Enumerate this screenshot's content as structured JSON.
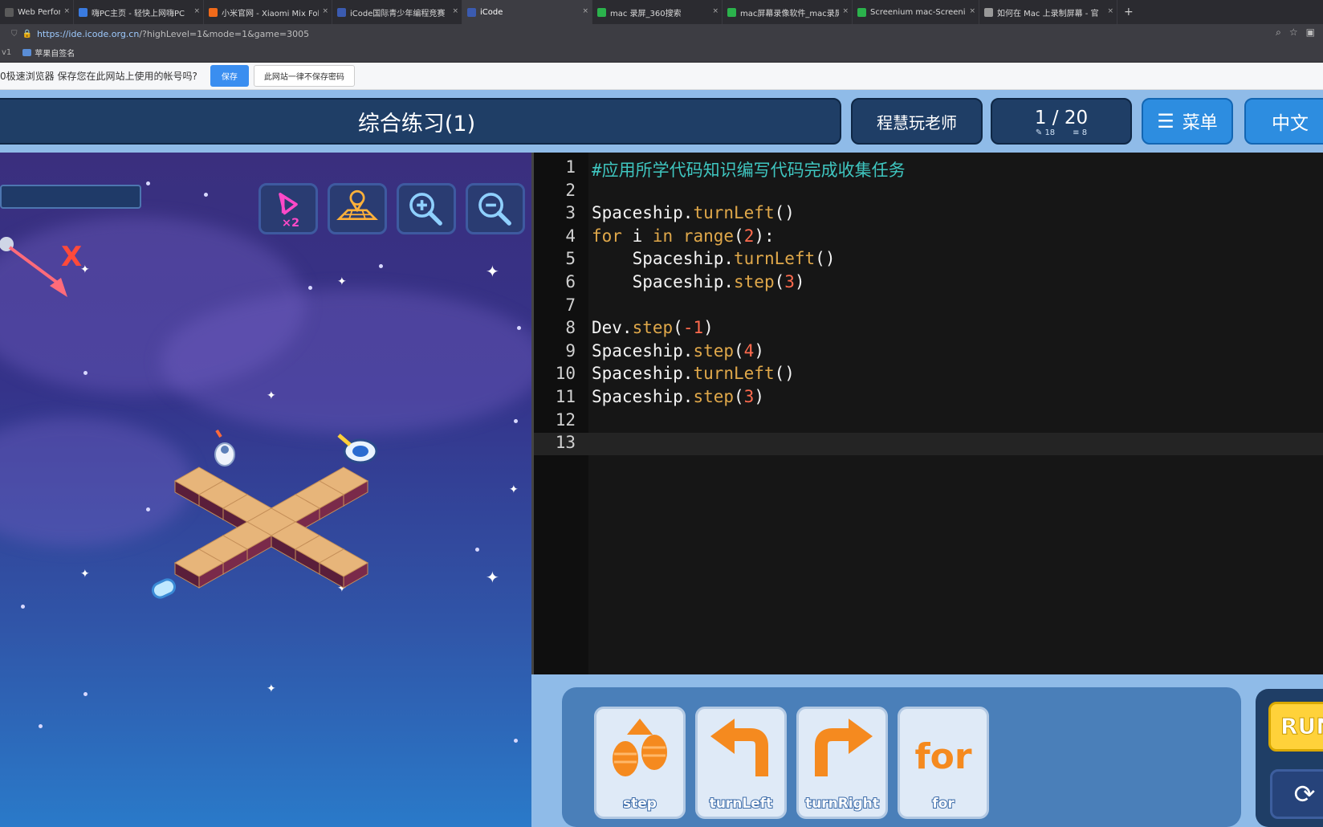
{
  "browser": {
    "tabs": [
      {
        "title": "Web Performan",
        "color": "#5a5a5a",
        "active": false
      },
      {
        "title": "嗨PC主页 - 轻快上网嗨PC",
        "color": "#3a7be0",
        "active": false
      },
      {
        "title": "小米官网 - Xiaomi Mix Fold",
        "color": "#f06a1a",
        "active": false
      },
      {
        "title": "iCode国际青少年编程竞赛",
        "color": "#3b5bb0",
        "active": false
      },
      {
        "title": "iCode",
        "color": "#3b5bb0",
        "active": true
      },
      {
        "title": "mac 录屏_360搜索",
        "color": "#2bb24c",
        "active": false
      },
      {
        "title": "mac屏幕录像软件_mac录屏",
        "color": "#2bb24c",
        "active": false
      },
      {
        "title": "Screenium mac-Screenium",
        "color": "#2bb24c",
        "active": false
      },
      {
        "title": "如何在 Mac 上录制屏幕 - 官",
        "color": "#999999",
        "active": false
      }
    ],
    "new_tab": "+",
    "url_host": "https://ide.icode.org.cn",
    "url_rest": "/?highLevel=1&mode=1&game=3005",
    "bookmark_prefix": "v1",
    "bookmark": "苹果自签名"
  },
  "password_bar": {
    "message": "0极速浏览器 保存您在此网站上使用的帐号吗?",
    "save": "保存",
    "never": "此网站一律不保存密码"
  },
  "header": {
    "level_title": "综合练习(1)",
    "teacher": "程慧玩老师",
    "progress": "1 / 20",
    "stat_a": "18",
    "stat_b": "8",
    "menu": "菜单",
    "language": "中文"
  },
  "scene": {
    "axis_label": "X"
  },
  "code": [
    [
      {
        "t": "#应用所学代码知识编写代码完成收集任务",
        "c": "com"
      }
    ],
    [],
    [
      {
        "t": "Spaceship."
      },
      {
        "t": "turnLeft",
        "c": "fn"
      },
      {
        "t": "()"
      }
    ],
    [
      {
        "t": "for",
        "c": "kw"
      },
      {
        "t": " i "
      },
      {
        "t": "in",
        "c": "kw"
      },
      {
        "t": " "
      },
      {
        "t": "range",
        "c": "fn"
      },
      {
        "t": "("
      },
      {
        "t": "2",
        "c": "num"
      },
      {
        "t": "):"
      }
    ],
    [
      {
        "t": "    Spaceship."
      },
      {
        "t": "turnLeft",
        "c": "fn"
      },
      {
        "t": "()"
      }
    ],
    [
      {
        "t": "    Spaceship."
      },
      {
        "t": "step",
        "c": "fn"
      },
      {
        "t": "("
      },
      {
        "t": "3",
        "c": "num"
      },
      {
        "t": ")"
      }
    ],
    [],
    [
      {
        "t": "Dev."
      },
      {
        "t": "step",
        "c": "fn"
      },
      {
        "t": "("
      },
      {
        "t": "-1",
        "c": "num"
      },
      {
        "t": ")"
      }
    ],
    [
      {
        "t": "Spaceship."
      },
      {
        "t": "step",
        "c": "fn"
      },
      {
        "t": "("
      },
      {
        "t": "4",
        "c": "num"
      },
      {
        "t": ")"
      }
    ],
    [
      {
        "t": "Spaceship."
      },
      {
        "t": "turnLeft",
        "c": "fn"
      },
      {
        "t": "()"
      }
    ],
    [
      {
        "t": "Spaceship."
      },
      {
        "t": "step",
        "c": "fn"
      },
      {
        "t": "("
      },
      {
        "t": "3",
        "c": "num"
      },
      {
        "t": ")"
      }
    ],
    [],
    []
  ],
  "toolbox": {
    "blocks": [
      {
        "label": "step",
        "icon": "step-icon"
      },
      {
        "label": "turnLeft",
        "icon": "turn-left-icon"
      },
      {
        "label": "turnRight",
        "icon": "turn-right-icon"
      },
      {
        "label": "for",
        "icon": "for-icon",
        "glyph": "for"
      }
    ],
    "run": "RUN"
  },
  "colors": {
    "header_bg": "#8fbbe8",
    "header_dark": "#1f3e66",
    "accent_blue": "#2d8de0",
    "code_comment": "#3fc6c0",
    "code_keyword": "#e0a84a",
    "code_number": "#ff6b4e",
    "run_yellow": "#ffd23a",
    "block_orange": "#f58a1f"
  }
}
